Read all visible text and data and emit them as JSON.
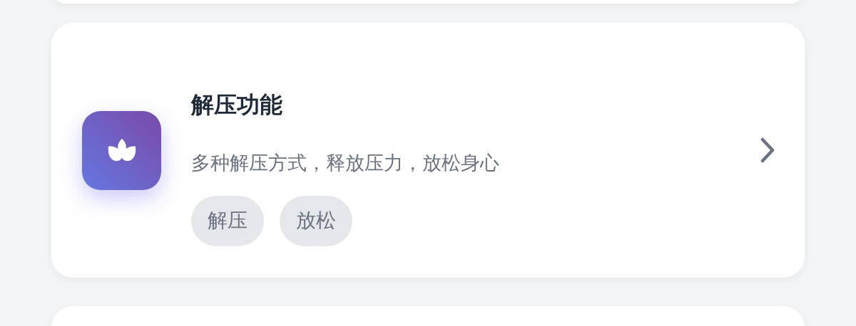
{
  "card": {
    "title": "解压功能",
    "description": "多种解压方式，释放压力，放松身心",
    "tags": [
      "解压",
      "放松"
    ]
  }
}
